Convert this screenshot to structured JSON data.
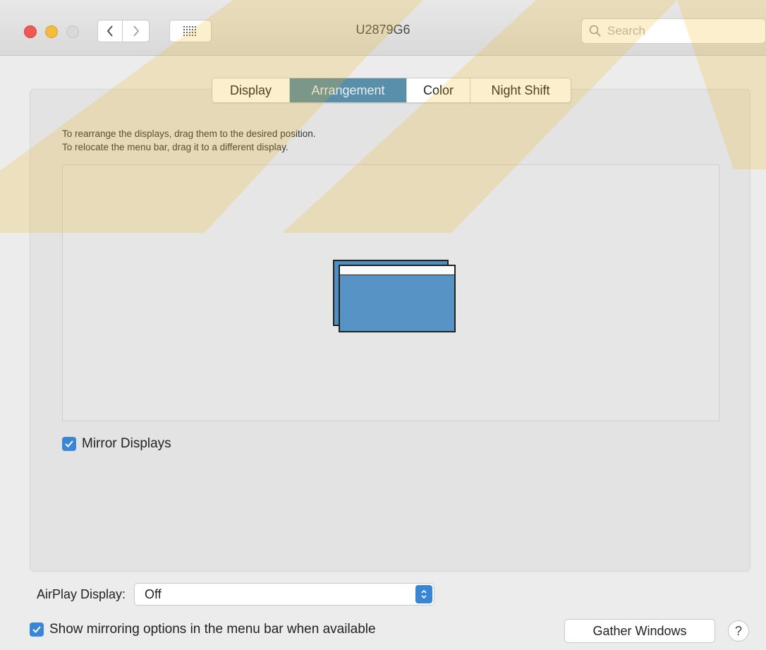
{
  "window": {
    "title": "U2879G6"
  },
  "search": {
    "placeholder": "Search"
  },
  "tabs": [
    {
      "label": "Display",
      "active": false
    },
    {
      "label": "Arrangement",
      "active": true
    },
    {
      "label": "Color",
      "active": false
    },
    {
      "label": "Night Shift",
      "active": false
    }
  ],
  "arrangement": {
    "instruction_line1": "To rearrange the displays, drag them to the desired position.",
    "instruction_line2": "To relocate the menu bar, drag it to a different display.",
    "mirror_displays": {
      "label": "Mirror Displays",
      "checked": true
    }
  },
  "airplay": {
    "label": "AirPlay Display:",
    "value": "Off"
  },
  "show_mirroring": {
    "label": "Show mirroring options in the menu bar when available",
    "checked": true
  },
  "buttons": {
    "gather_windows": "Gather Windows",
    "help": "?"
  },
  "colors": {
    "accent": "#3a86d6",
    "selected_tab": "#5a8faa",
    "display_blue": "#5793c5"
  }
}
